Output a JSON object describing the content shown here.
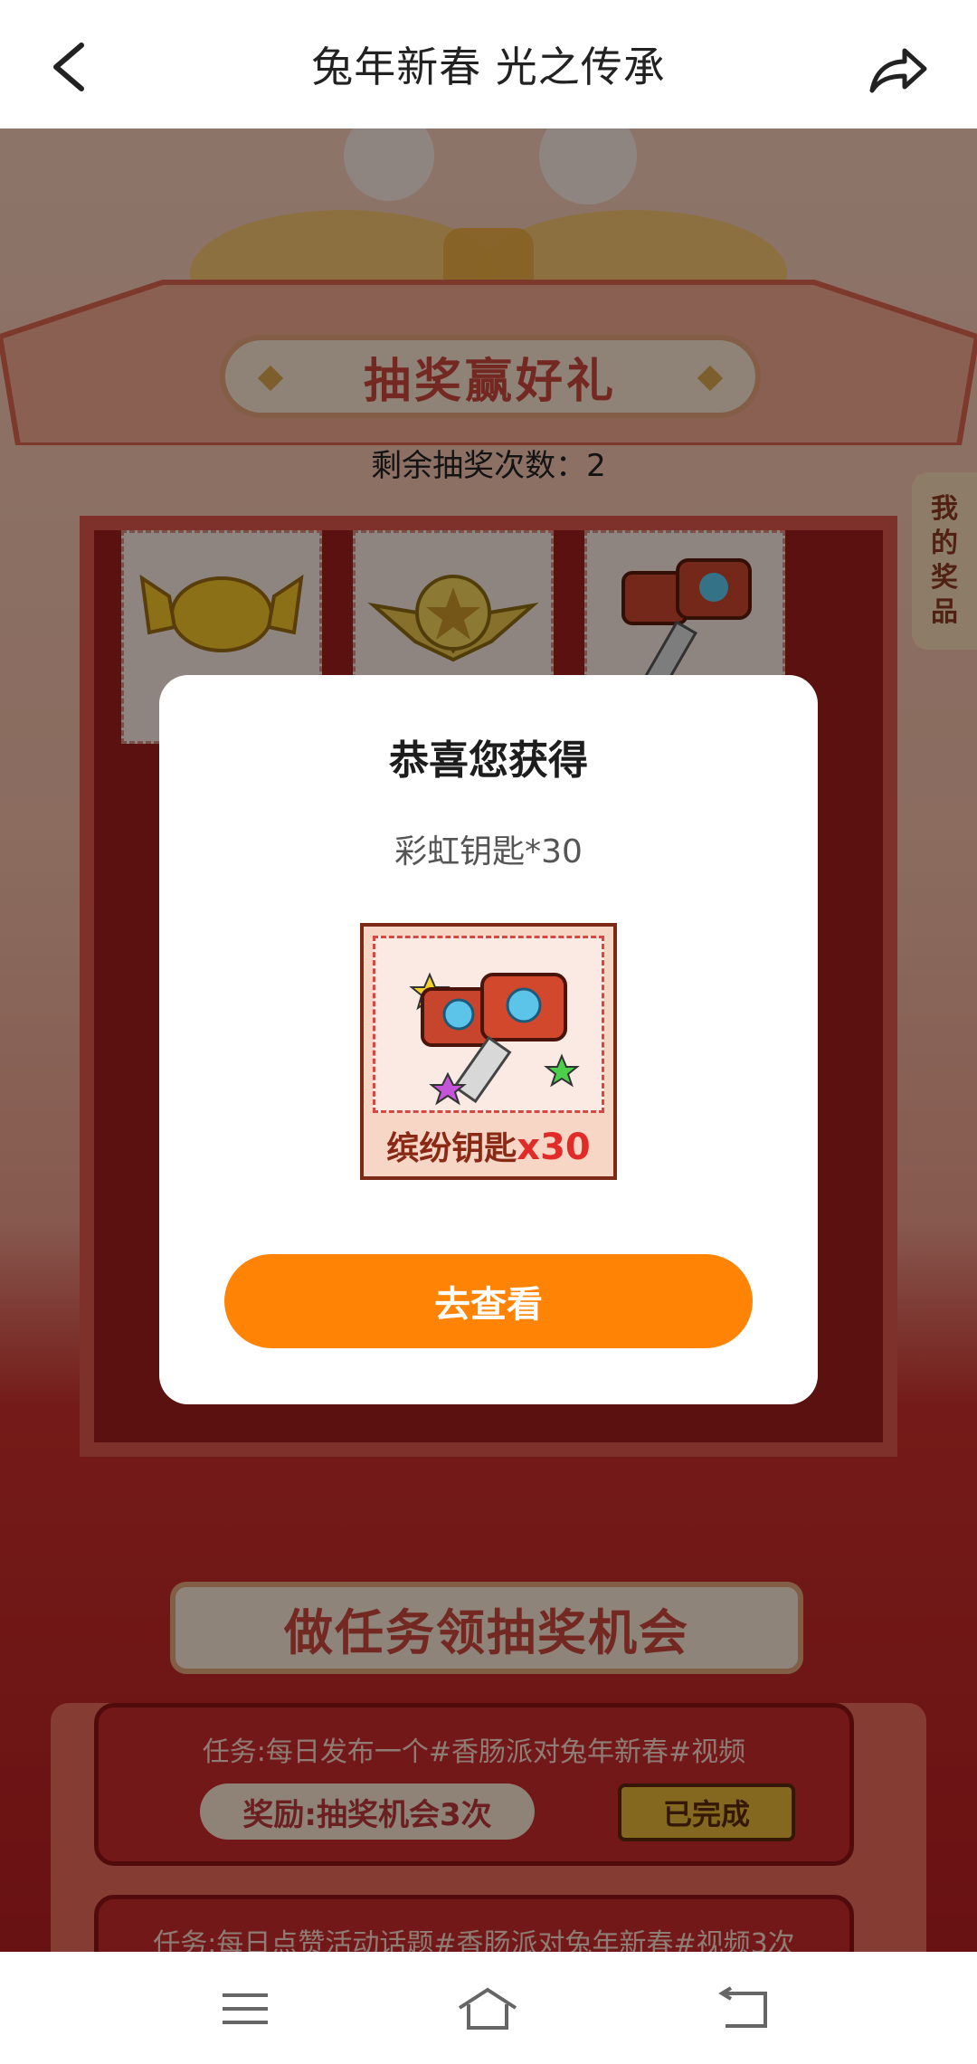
{
  "header": {
    "title": "兔年新春 光之传承",
    "back_icon": "chevron-left-icon",
    "share_icon": "share-icon"
  },
  "lottery": {
    "banner": "抽奖赢好礼",
    "remaining_label": "剩余抽奖次数：",
    "remaining_count": "2",
    "my_prizes": [
      "我",
      "的",
      "奖",
      "品"
    ]
  },
  "dialog": {
    "title": "恭喜您获得",
    "prize_text": "彩虹钥匙*30",
    "card_label": "缤纷钥匙",
    "card_qty": "x30",
    "button": "去查看"
  },
  "tasks": {
    "banner": "做任务领抽奖机会",
    "items": [
      {
        "text": "任务:每日发布一个#香肠派对兔年新春#视频",
        "reward": "奖励:抽奖机会3次",
        "status": "已完成"
      },
      {
        "text": "任务:每日点赞活动话题#香肠派对兔年新春#视频3次"
      }
    ]
  },
  "navbar": {
    "icons": [
      "menu-icon",
      "home-icon",
      "back-icon"
    ]
  },
  "colors": {
    "accent": "#ff8305",
    "dialog_bg": "#ffffff",
    "prize_qty": "#e12b29"
  }
}
